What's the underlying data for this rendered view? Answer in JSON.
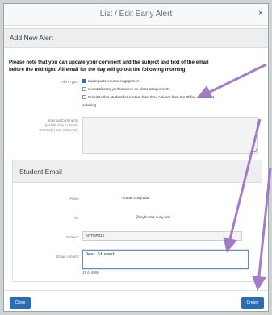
{
  "modal": {
    "title": "List / Edit Early Alert",
    "close_label": "×"
  },
  "add_alert": {
    "heading": "Add New Alert",
    "notice_line1": "Please note that you can update your comment and the subject and text of the email",
    "notice_line2": "before the midnight. All email for the day will go out the following morning.",
    "alert_type_label": "Alert Type:",
    "options": [
      {
        "label": "Inadequate course engagement",
        "checked": true
      },
      {
        "label": "Unsatisfactory performance on class assignments",
        "checked": false
      },
      {
        "label": "Prioritize this student for contact from their Advisor from the Office of Student",
        "checked": false
      }
    ],
    "option3_line2": "Advising",
    "internal_label_line1": "Internal Comments",
    "internal_label_line2": "(visible only to the in-",
    "internal_label_line3": "structor(s) and Advisors):"
  },
  "email": {
    "heading": "Student Email",
    "from_label": "From:",
    "from_value": "*hunter.cuny.edu",
    "to_label": "To:",
    "to_value": "@myhunter.cuny.edu",
    "subject_label": "Subject:",
    "subject_value": "ANTHP312",
    "content_label": "Email content:",
    "content_value": "Dear Student...",
    "counter": "15 of 4000"
  },
  "footer": {
    "close_label": "Close",
    "create_label": "Create"
  },
  "colors": {
    "primary_button": "#2a6db5",
    "annotation_arrow": "#9b6fc1"
  }
}
